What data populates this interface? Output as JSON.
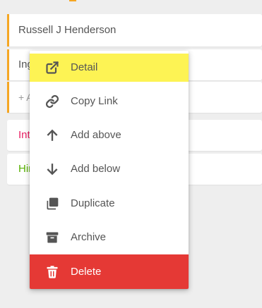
{
  "cards": [
    {
      "text": "Russell J Henderson"
    },
    {
      "text": "Ing"
    },
    {
      "text": "+ A"
    },
    {
      "text": "Int"
    },
    {
      "text": "Hir"
    }
  ],
  "menu": {
    "items": [
      {
        "label": "Detail",
        "icon": "external-link-icon",
        "highlighted": true
      },
      {
        "label": "Copy Link",
        "icon": "link-icon"
      },
      {
        "label": "Add above",
        "icon": "arrow-up-icon"
      },
      {
        "label": "Add below",
        "icon": "arrow-down-icon"
      },
      {
        "label": "Duplicate",
        "icon": "duplicate-icon"
      },
      {
        "label": "Archive",
        "icon": "archive-icon"
      },
      {
        "label": "Delete",
        "icon": "trash-icon",
        "danger": true
      }
    ]
  },
  "colors": {
    "highlight": "#fdf354",
    "danger": "#e53935",
    "accent_orange": "#f5a623",
    "pink_text": "#e91e63",
    "green_text": "#56b000"
  }
}
